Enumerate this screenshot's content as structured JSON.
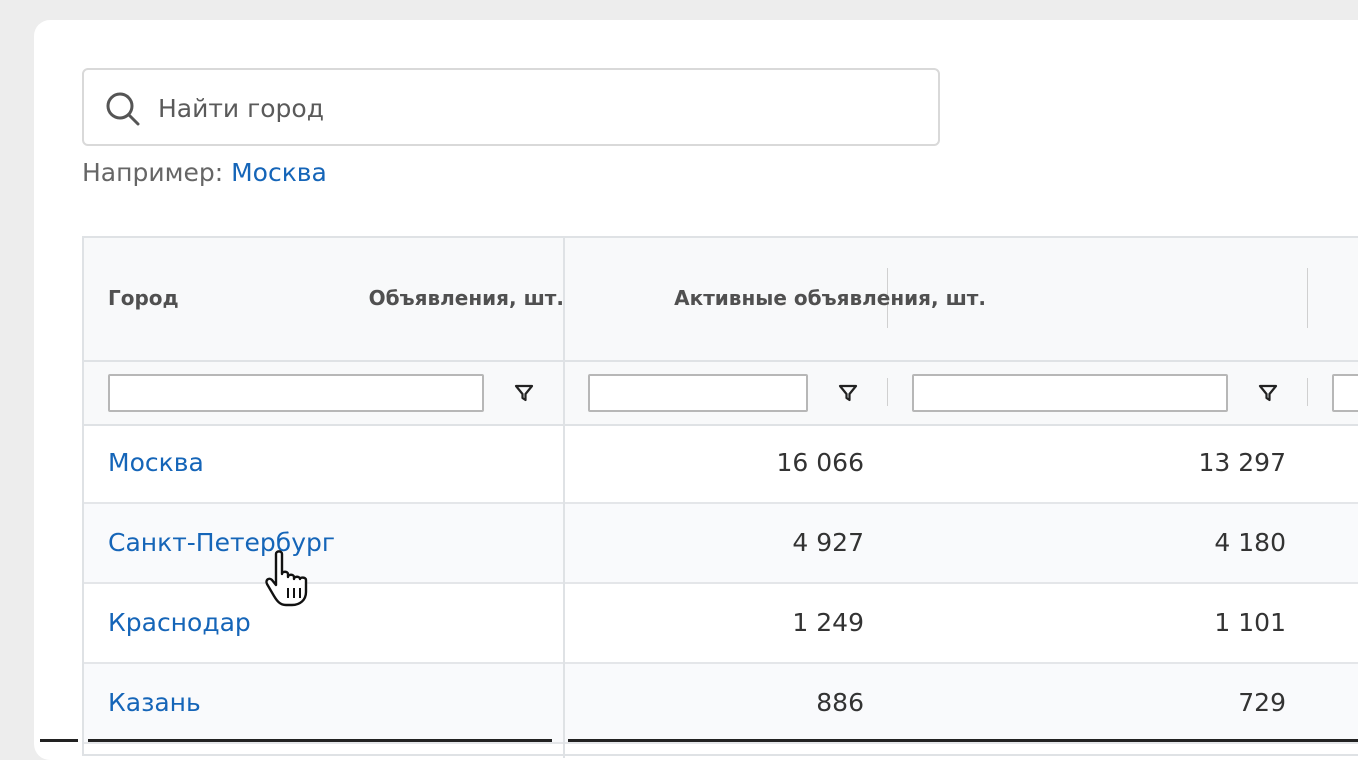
{
  "search": {
    "placeholder": "Найти город",
    "icon": "search-icon"
  },
  "example": {
    "prefix": "Например:",
    "link": "Москва"
  },
  "table": {
    "columns": [
      "Город",
      "Объявления, шт.",
      "Активные объявления, шт."
    ],
    "filter_icon": "funnel-icon",
    "rows": [
      {
        "city": "Москва",
        "listings": "16 066",
        "active": "13 297"
      },
      {
        "city": "Санкт-Петербург",
        "listings": "4 927",
        "active": "4 180"
      },
      {
        "city": "Краснодар",
        "listings": "1 249",
        "active": "1 101"
      },
      {
        "city": "Казань",
        "listings": "886",
        "active": "729"
      }
    ]
  },
  "colors": {
    "link": "#1565b8",
    "header_bg": "#f8f9fa",
    "border": "#dfe2e5"
  }
}
